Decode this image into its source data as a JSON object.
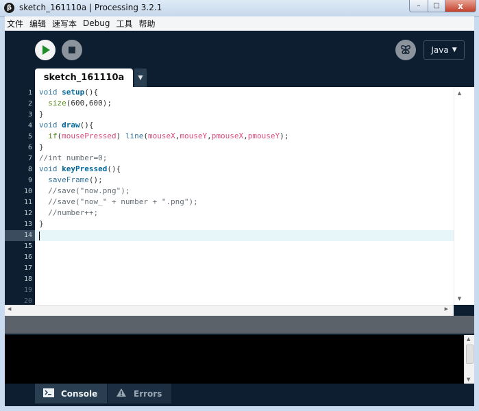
{
  "window": {
    "title": "sketch_161110a | Processing 3.2.1",
    "app_icon_glyph": "β",
    "minimize_glyph": "–",
    "maximize_glyph": "□",
    "close_glyph": "x"
  },
  "menu": [
    "文件",
    "编辑",
    "速写本",
    "Debug",
    "工具",
    "帮助"
  ],
  "toolbar": {
    "mode": "Java",
    "mode_arrow": "▼"
  },
  "tab": {
    "name": "sketch_161110a",
    "menu_arrow": "▼"
  },
  "editor": {
    "line_numbers": [
      "1",
      "2",
      "3",
      "4",
      "5",
      "6",
      "7",
      "8",
      "9",
      "10",
      "11",
      "12",
      "13",
      "14",
      "15",
      "16",
      "17",
      "18",
      "19",
      "20"
    ],
    "current_line": 14,
    "code": [
      [
        {
          "t": "void",
          "c": "kw-void"
        },
        {
          "t": " "
        },
        {
          "t": "setup",
          "c": "kw-fn"
        },
        {
          "t": "(){"
        }
      ],
      [
        {
          "t": "  "
        },
        {
          "t": "size",
          "c": "kw-api"
        },
        {
          "t": "(600,600);"
        }
      ],
      [
        {
          "t": "}"
        }
      ],
      [
        {
          "t": "void",
          "c": "kw-void"
        },
        {
          "t": " "
        },
        {
          "t": "draw",
          "c": "kw-fn"
        },
        {
          "t": "(){"
        }
      ],
      [
        {
          "t": "  "
        },
        {
          "t": "if",
          "c": "kw-api"
        },
        {
          "t": "("
        },
        {
          "t": "mousePressed",
          "c": "kw-var"
        },
        {
          "t": ") "
        },
        {
          "t": "line",
          "c": "kw-void"
        },
        {
          "t": "("
        },
        {
          "t": "mouseX",
          "c": "kw-var"
        },
        {
          "t": ","
        },
        {
          "t": "mouseY",
          "c": "kw-var"
        },
        {
          "t": ","
        },
        {
          "t": "pmouseX",
          "c": "kw-var"
        },
        {
          "t": ","
        },
        {
          "t": "pmouseY",
          "c": "kw-var"
        },
        {
          "t": ");"
        }
      ],
      [
        {
          "t": "}"
        }
      ],
      [
        {
          "t": "//int number=0;",
          "c": "kw-cm"
        }
      ],
      [
        {
          "t": "void",
          "c": "kw-void"
        },
        {
          "t": " "
        },
        {
          "t": "keyPressed",
          "c": "kw-fn"
        },
        {
          "t": "(){"
        }
      ],
      [
        {
          "t": "  "
        },
        {
          "t": "saveFrame",
          "c": "kw-void"
        },
        {
          "t": "();"
        }
      ],
      [
        {
          "t": "  //save(\"now.png\");",
          "c": "kw-cm"
        }
      ],
      [
        {
          "t": "  //save(\"now_\" + number + \".png\");",
          "c": "kw-cm"
        }
      ],
      [
        {
          "t": "  //number++;",
          "c": "kw-cm"
        }
      ],
      [
        {
          "t": "}"
        }
      ],
      [
        {
          "t": ""
        }
      ]
    ]
  },
  "bottom_tabs": {
    "console": "Console",
    "errors": "Errors"
  }
}
